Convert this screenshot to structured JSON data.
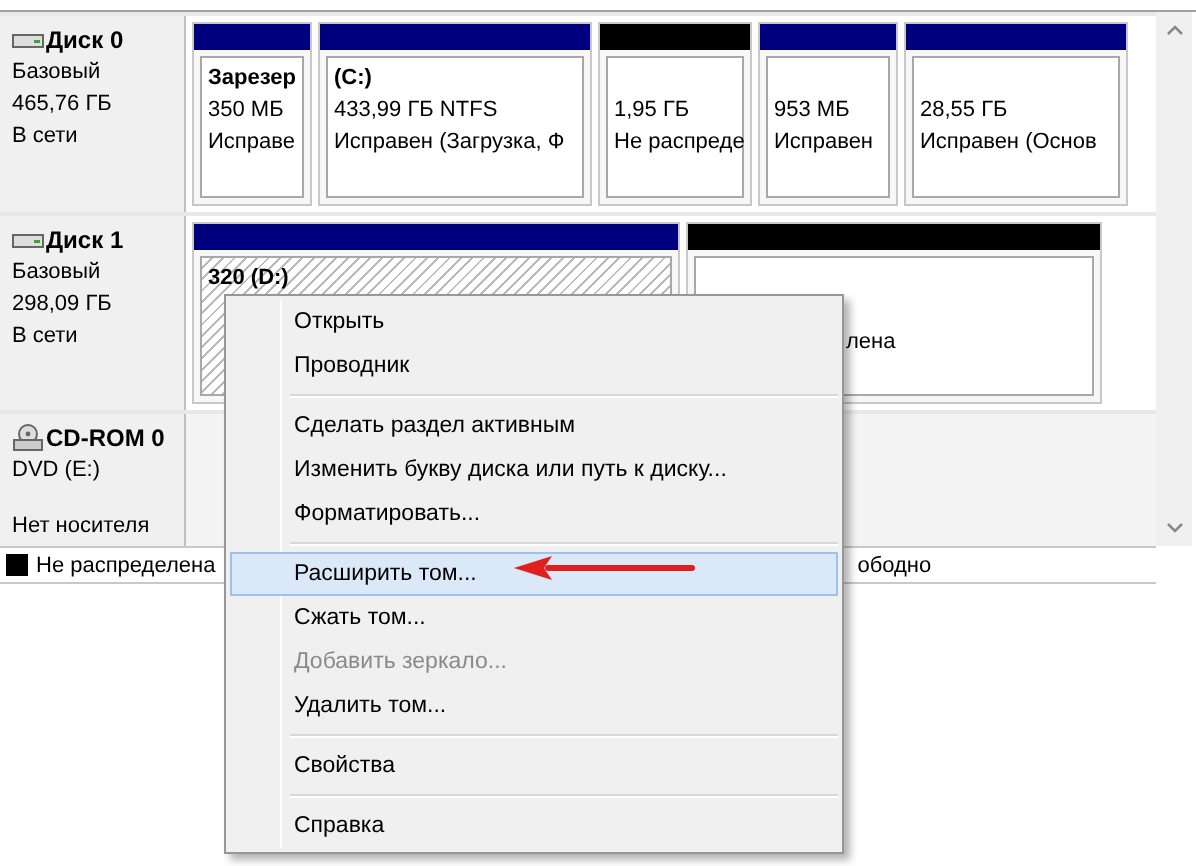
{
  "disks": [
    {
      "kind": "disk",
      "name": "Диск 0",
      "lines": [
        "Базовый",
        "465,76 ГБ",
        "В сети"
      ],
      "partitions": [
        {
          "kind": "primary",
          "selected": false,
          "title": "Зарезер",
          "lines": [
            "350 МБ",
            "Исправе"
          ]
        },
        {
          "kind": "primary",
          "selected": false,
          "title": "(C:)",
          "lines": [
            "433,99 ГБ NTFS",
            "Исправен (Загрузка, Ф"
          ]
        },
        {
          "kind": "unallocated",
          "selected": false,
          "lines": [
            "1,95 ГБ",
            "Не распреде"
          ]
        },
        {
          "kind": "primary",
          "selected": false,
          "lines": [
            "953 МБ",
            "Исправен"
          ]
        },
        {
          "kind": "primary",
          "selected": false,
          "lines": [
            "28,55 ГБ",
            "Исправен (Основ"
          ]
        }
      ]
    },
    {
      "kind": "disk",
      "name": "Диск 1",
      "lines": [
        "Базовый",
        "298,09 ГБ",
        "В сети"
      ],
      "partitions": [
        {
          "kind": "primary",
          "selected": true,
          "title": "320  (D:)"
        },
        {
          "kind": "unallocated",
          "selected": false,
          "status": "лена"
        }
      ]
    },
    {
      "kind": "cdrom",
      "name": "CD-ROM 0",
      "lines": [
        "DVD (E:)"
      ],
      "status": "Нет носителя"
    }
  ],
  "legend": [
    {
      "label": "Не распределена",
      "color": "#000000"
    },
    {
      "label": "ободно"
    }
  ],
  "context_menu": {
    "groups": [
      [
        {
          "label": "Открыть",
          "selected": false,
          "disabled": false
        },
        {
          "label": "Проводник",
          "selected": false,
          "disabled": false
        }
      ],
      [
        {
          "label": "Сделать раздел активным",
          "selected": false,
          "disabled": false
        },
        {
          "label": "Изменить букву диска или путь к диску...",
          "selected": false,
          "disabled": false
        },
        {
          "label": "Форматировать...",
          "selected": false,
          "disabled": false
        }
      ],
      [
        {
          "label": "Расширить том...",
          "selected": true,
          "disabled": false
        },
        {
          "label": "Сжать том...",
          "selected": false,
          "disabled": false
        },
        {
          "label": "Добавить зеркало...",
          "selected": false,
          "disabled": true
        },
        {
          "label": "Удалить том...",
          "selected": false,
          "disabled": false
        }
      ],
      [
        {
          "label": "Свойства",
          "selected": false,
          "disabled": false
        }
      ],
      [
        {
          "label": "Справка",
          "selected": false,
          "disabled": false
        }
      ]
    ]
  }
}
